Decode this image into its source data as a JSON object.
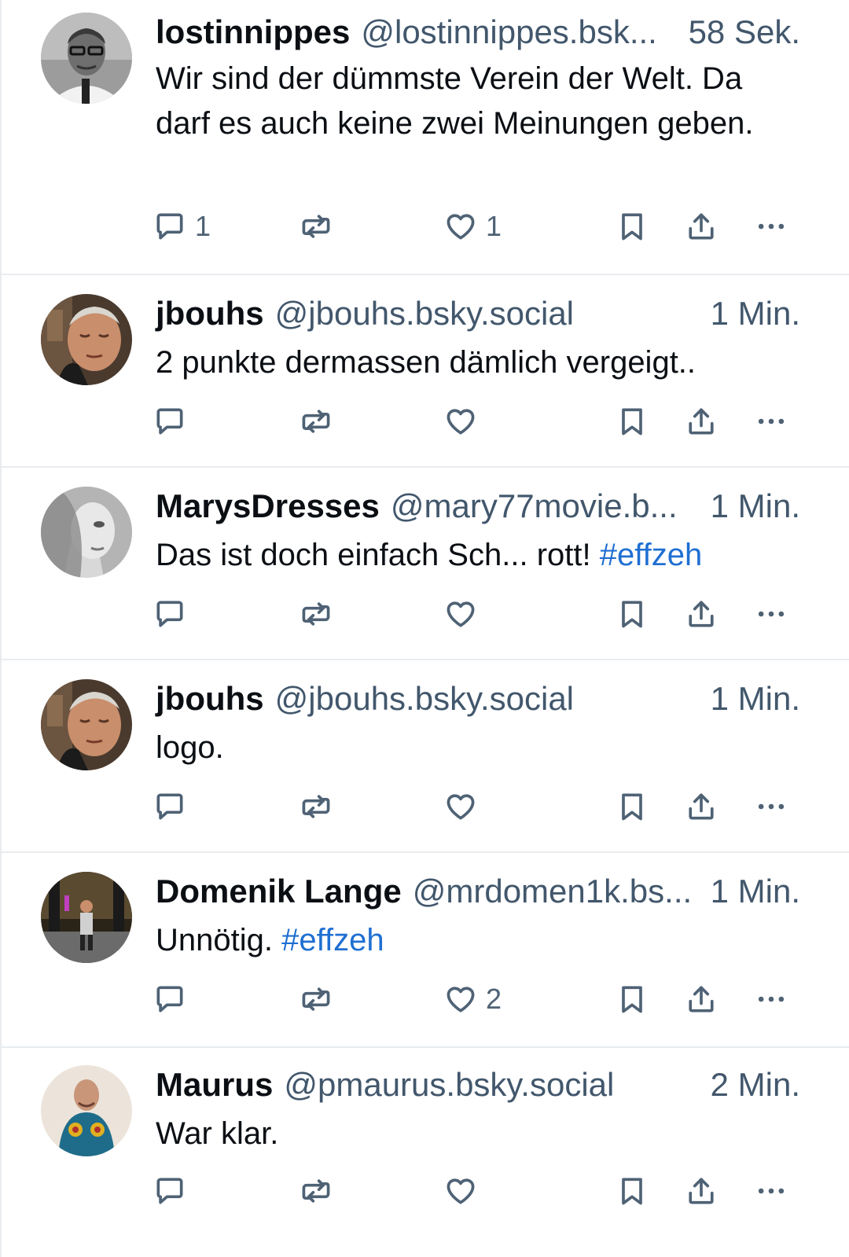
{
  "colors": {
    "icon": "#4f6275",
    "meta": "#42576c",
    "text": "#0b0f14",
    "hashtag": "#1f6fd2",
    "divider": "#e9ecef"
  },
  "posts": [
    {
      "name": "lostinnippes",
      "handle": "@lostinnippes.bsk...",
      "time": "58 Sek.",
      "text": "Wir sind der dümmste Verein der Welt. Da darf es auch keine zwei Meinungen geben.",
      "hashtag": "",
      "replies": "1",
      "reposts": "",
      "likes": "1"
    },
    {
      "name": "jbouhs",
      "handle": "@jbouhs.bsky.social",
      "time": "1 Min.",
      "text": "2 punkte dermassen dämlich vergeigt..",
      "hashtag": "",
      "replies": "",
      "reposts": "",
      "likes": ""
    },
    {
      "name": "MarysDresses",
      "handle": "@mary77movie.b...",
      "time": "1 Min.",
      "text": "Das ist doch einfach Sch... rott! ",
      "hashtag": "#effzeh",
      "replies": "",
      "reposts": "",
      "likes": ""
    },
    {
      "name": "jbouhs",
      "handle": "@jbouhs.bsky.social",
      "time": "1 Min.",
      "text": "logo.",
      "hashtag": "",
      "replies": "",
      "reposts": "",
      "likes": ""
    },
    {
      "name": "Domenik Lange",
      "handle": "@mrdomen1k.bs...",
      "time": "1 Min.",
      "text": "Unnötig. ",
      "hashtag": "#effzeh",
      "replies": "",
      "reposts": "",
      "likes": "2"
    },
    {
      "name": "Maurus",
      "handle": "@pmaurus.bsky.social",
      "time": "2 Min.",
      "text": "War klar.",
      "hashtag": "",
      "replies": "",
      "reposts": "",
      "likes": ""
    }
  ],
  "icons": {
    "reply": "reply-icon",
    "repost": "repost-icon",
    "like": "heart-icon",
    "bookmark": "bookmark-icon",
    "share": "share-icon",
    "more": "more-options-icon"
  }
}
